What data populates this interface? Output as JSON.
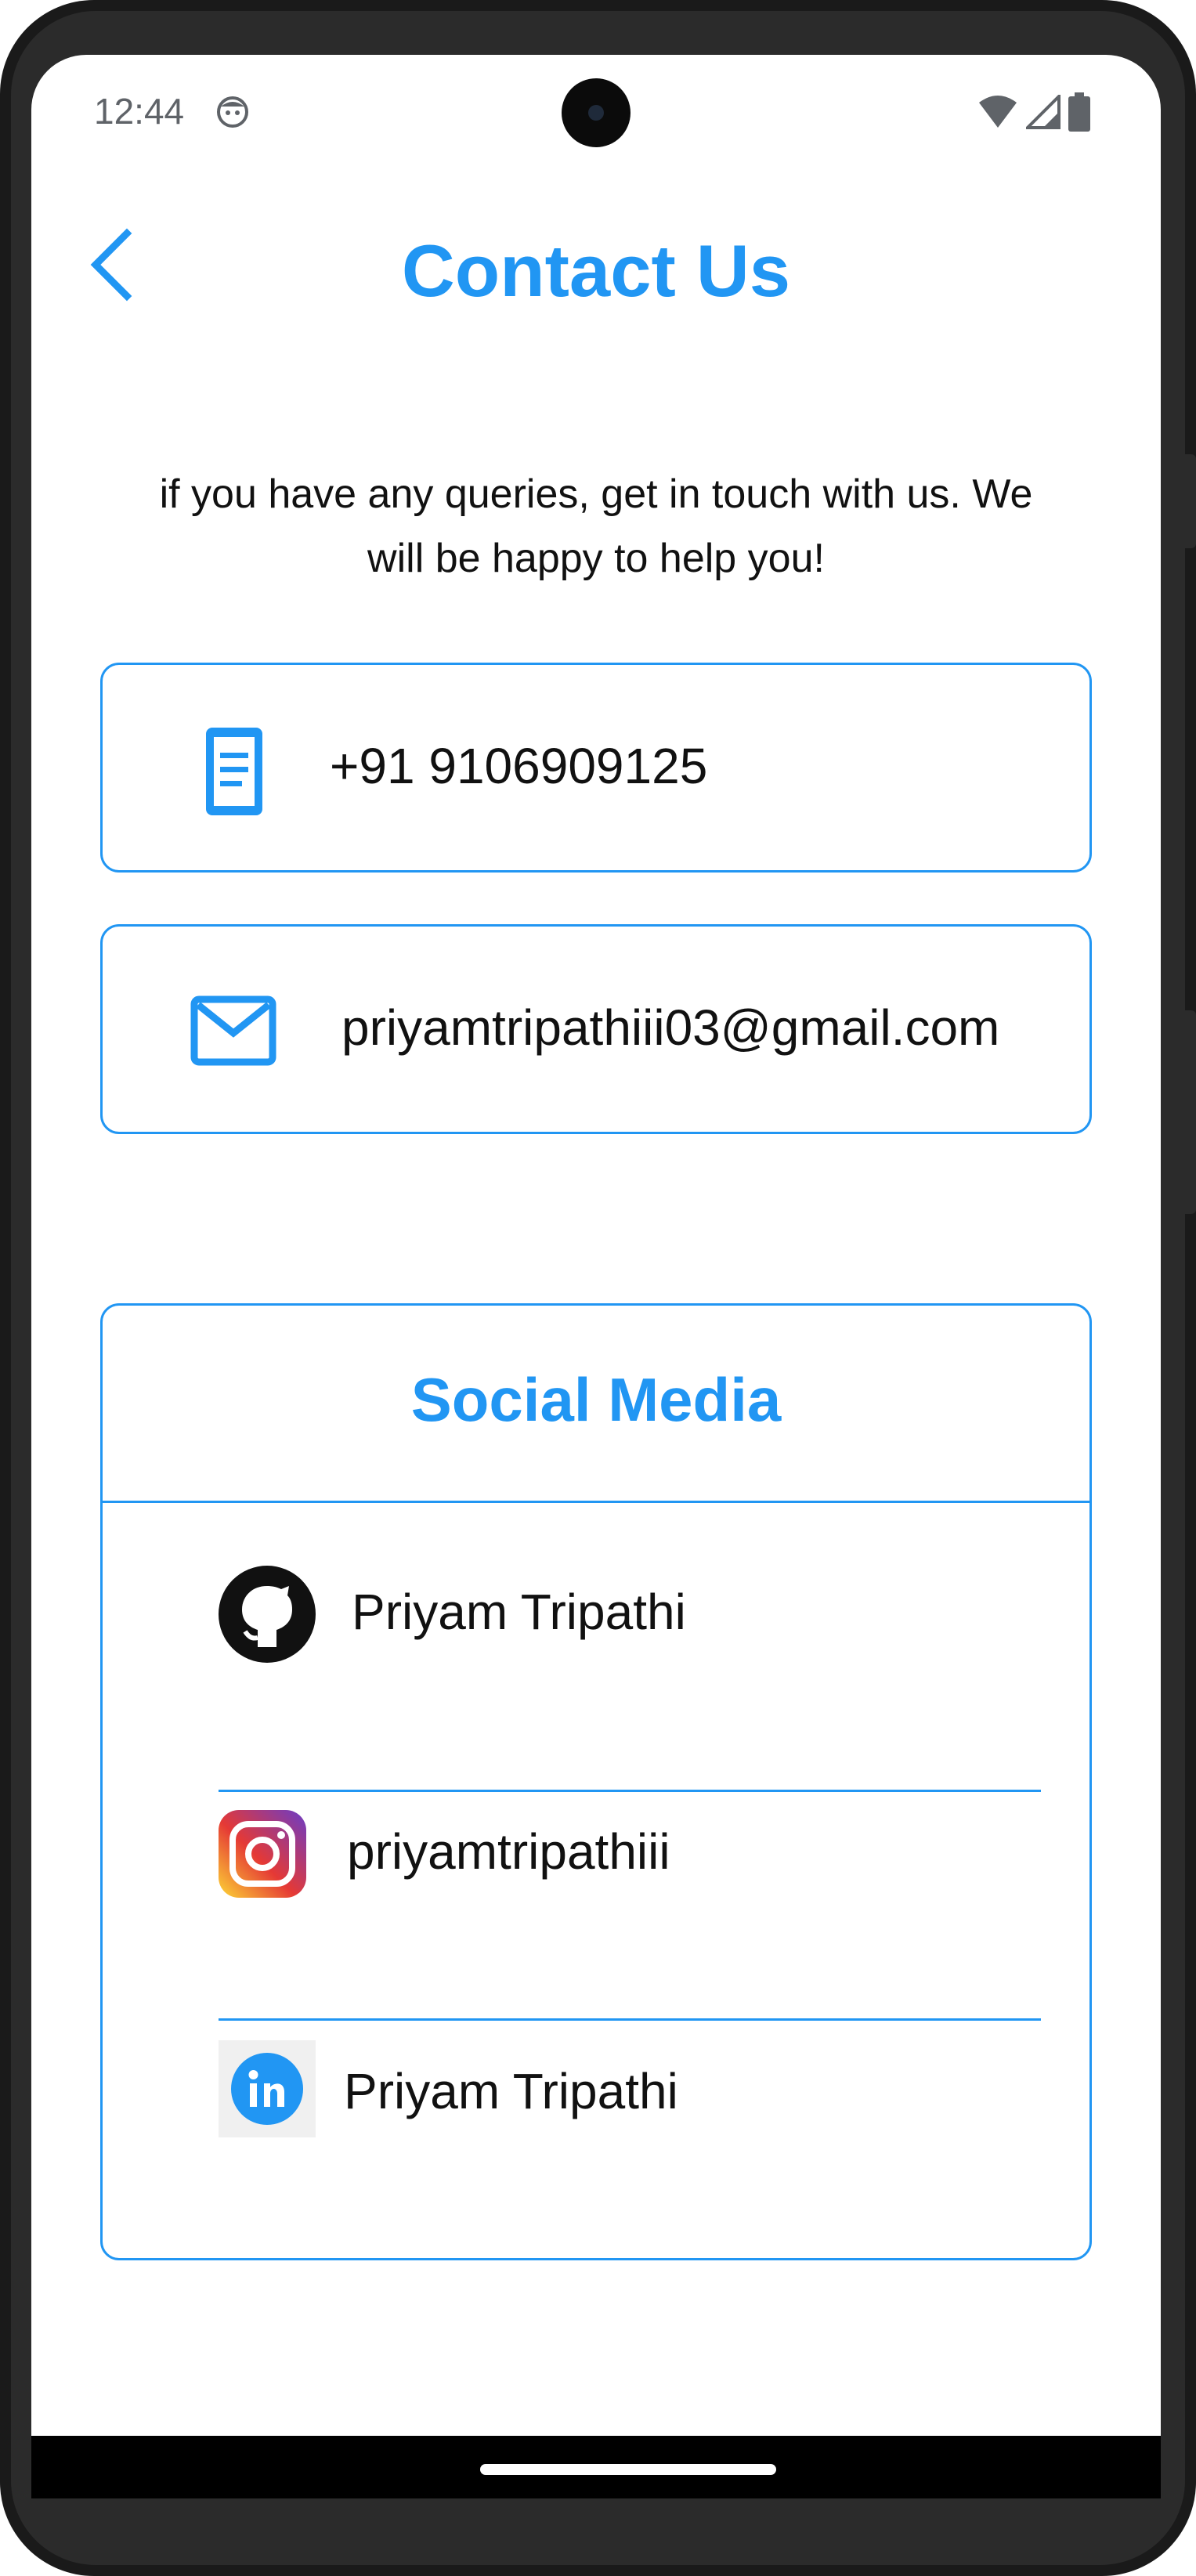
{
  "status_bar": {
    "time": "12:44"
  },
  "header": {
    "title": "Contact Us"
  },
  "intro": {
    "text": "if you have any queries, get in touch with us. We will be happy to help you!"
  },
  "contacts": {
    "phone": "+91 9106909125",
    "email": "priyamtripathiii03@gmail.com"
  },
  "social": {
    "title": "Social Media",
    "github": "Priyam Tripathi",
    "instagram": "priyamtripathiii",
    "linkedin": "Priyam Tripathi"
  },
  "colors": {
    "accent": "#2196f3",
    "text": "#111111"
  },
  "icons": {
    "back": "chevron-left-icon",
    "phone": "smartphone-icon",
    "email": "mail-icon",
    "github": "github-icon",
    "instagram": "instagram-icon",
    "linkedin": "linkedin-icon"
  }
}
